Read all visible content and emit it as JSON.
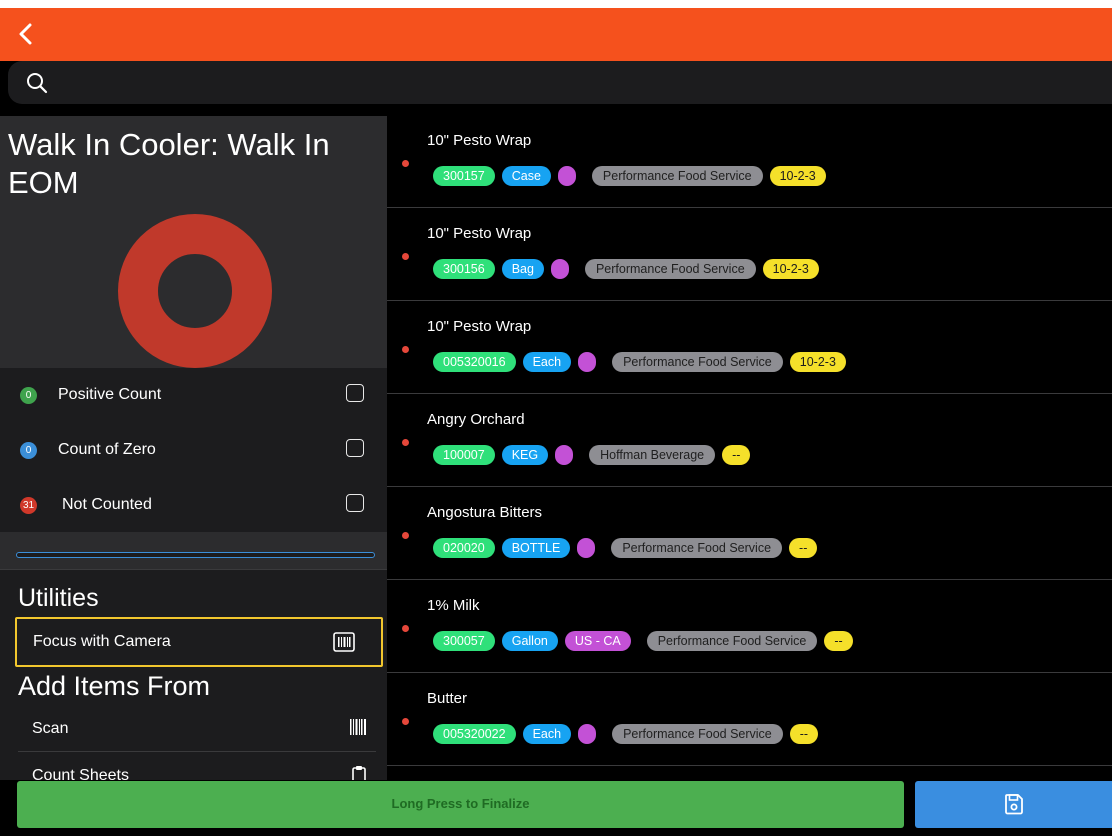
{
  "header": {
    "back_icon": "chevron-left-icon",
    "accent": "#f5511d"
  },
  "search": {
    "icon": "search-icon"
  },
  "left": {
    "title": "Walk In Cooler: Walk In EOM",
    "legend": [
      {
        "count": "0",
        "label": "Positive Count",
        "color": "#3fa34d"
      },
      {
        "count": "0",
        "label": "Count of Zero",
        "color": "#3b8fd9"
      },
      {
        "count": "31",
        "label": "Not Counted",
        "color": "#c0392b"
      }
    ],
    "progress": 0,
    "utilities_heading": "Utilities",
    "focus_label": "Focus with Camera",
    "add_heading": "Add Items From",
    "add_items": [
      {
        "label": "Scan",
        "icon": "barcode-icon"
      },
      {
        "label": "Count Sheets",
        "icon": "clipboard-icon"
      }
    ]
  },
  "items": [
    {
      "name": "10\" Pesto Wrap",
      "code": "300157",
      "unit": "Case",
      "category": "",
      "vendor": "Performance Food Service",
      "location": "10-2-3"
    },
    {
      "name": "10\" Pesto Wrap",
      "code": "300156",
      "unit": "Bag",
      "category": "",
      "vendor": "Performance Food Service",
      "location": "10-2-3"
    },
    {
      "name": "10\" Pesto Wrap",
      "code": "005320016",
      "unit": "Each",
      "category": "",
      "vendor": "Performance Food Service",
      "location": "10-2-3"
    },
    {
      "name": "Angry Orchard",
      "code": "100007",
      "unit": "KEG",
      "category": "",
      "vendor": "Hoffman Beverage",
      "location": "--"
    },
    {
      "name": "Angostura Bitters",
      "code": "020020",
      "unit": "BOTTLE",
      "category": "",
      "vendor": "Performance Food Service",
      "location": "--"
    },
    {
      "name": "1% Milk",
      "code": "300057",
      "unit": "Gallon",
      "category": "US - CA",
      "vendor": "Performance Food Service",
      "location": "--"
    },
    {
      "name": "Butter",
      "code": "005320022",
      "unit": "Each",
      "category": "",
      "vendor": "Performance Food Service",
      "location": "--"
    }
  ],
  "footer": {
    "finalize_label": "Long Press to Finalize",
    "save_icon": "save-icon"
  }
}
